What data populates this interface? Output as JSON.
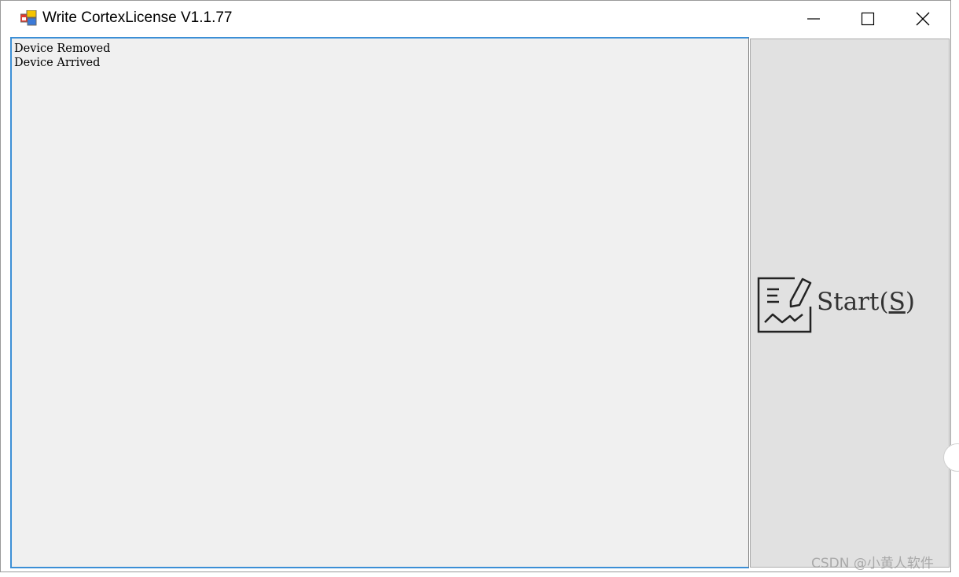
{
  "window": {
    "title": "Write CortexLicense V1.1.77",
    "controls": {
      "minimize_icon": "minimize-icon",
      "maximize_icon": "maximize-icon",
      "close_icon": "close-icon"
    }
  },
  "log": {
    "lines": [
      "Device Removed",
      "Device Arrived"
    ]
  },
  "start_button": {
    "label": "Start",
    "open_paren": "(",
    "hotkey": "S",
    "close_paren": ")",
    "icon": "sign-document-icon"
  },
  "watermark": "CSDN @小黄人软件",
  "colors": {
    "accent_border": "#3c8fd6",
    "log_background": "#f0f0f0",
    "button_background": "#e1e1e1"
  }
}
